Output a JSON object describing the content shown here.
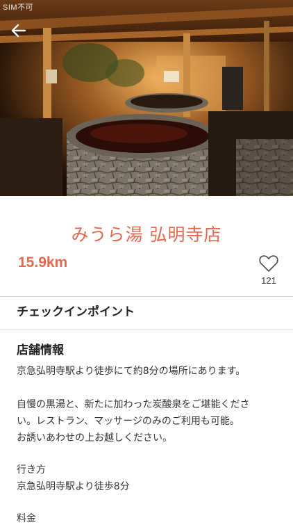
{
  "status_bar": {
    "carrier": "SIM不可"
  },
  "shop": {
    "name": "みうら湯 弘明寺店",
    "distance": "15.9km",
    "favorite_count": "121"
  },
  "checkin": {
    "label": "チェックインポイント"
  },
  "info": {
    "heading": "店舗情報",
    "intro": "京急弘明寺駅より徒歩にて約8分の場所にあります。",
    "desc_line1": "自慢の黒湯と、新たに加わった炭酸泉をご堪能くださ",
    "desc_line2": "い。レストラン、マッサージのみのご利用も可能。",
    "desc_line3": "お誘いあわせの上お越しください。",
    "access_label": "行き方",
    "access_value": "京急弘明寺駅より徒歩8分",
    "price_label": "料金"
  },
  "icons": {
    "back": "arrow-left-icon",
    "favorite": "heart-outline-icon"
  },
  "colors": {
    "accent": "#e2694e"
  }
}
